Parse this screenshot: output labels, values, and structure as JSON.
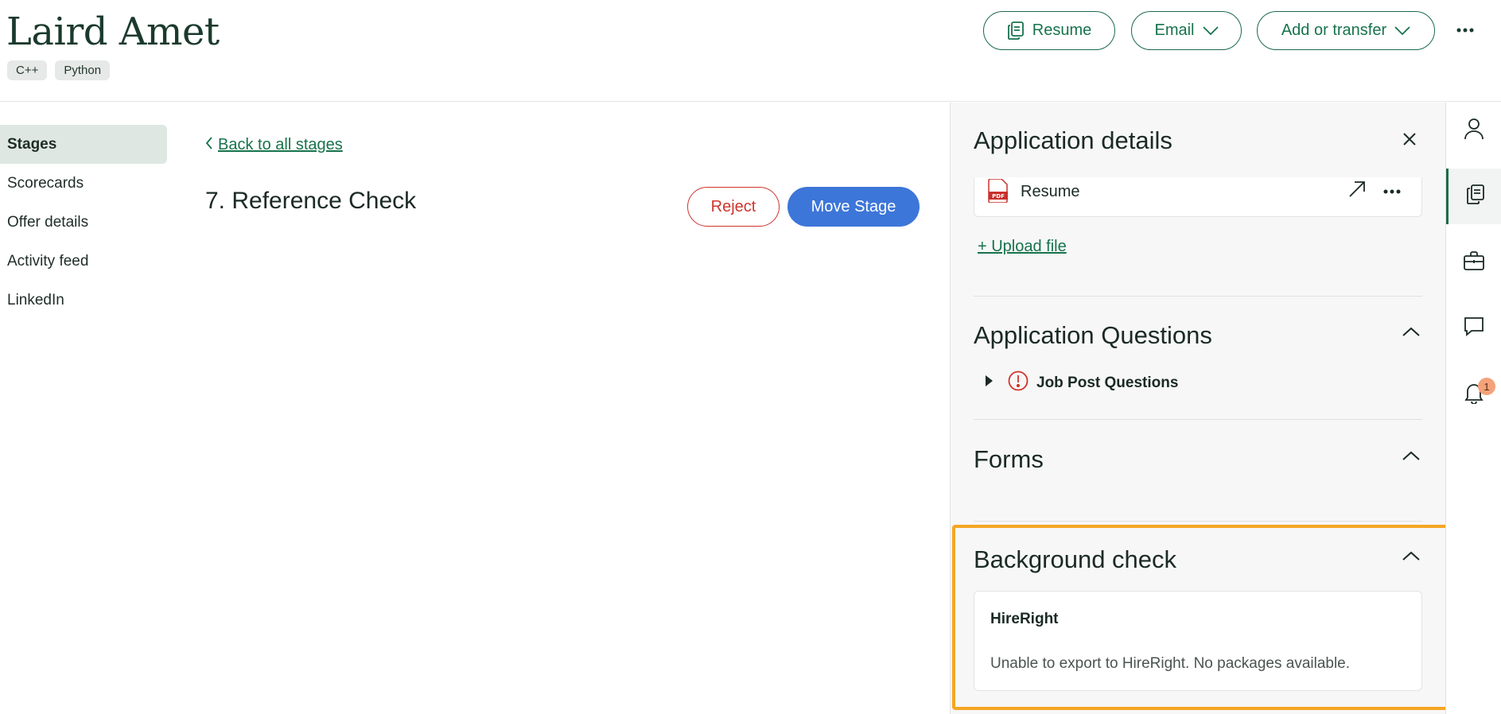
{
  "candidate": {
    "name": "Laird Amet",
    "tags": [
      "C++",
      "Python"
    ]
  },
  "header": {
    "resume_label": "Resume",
    "email_label": "Email",
    "transfer_label": "Add or transfer"
  },
  "leftnav": {
    "items": [
      {
        "label": "Stages",
        "active": true
      },
      {
        "label": "Scorecards",
        "active": false
      },
      {
        "label": "Offer details",
        "active": false
      },
      {
        "label": "Activity feed",
        "active": false
      },
      {
        "label": "LinkedIn",
        "active": false
      }
    ]
  },
  "main": {
    "back_label": "Back to all stages",
    "stage_title": "7. Reference Check",
    "reject_label": "Reject",
    "move_label": "Move Stage"
  },
  "panel": {
    "title": "Application details",
    "file_name": "Resume",
    "upload_label": "+ Upload file",
    "questions_title": "Application Questions",
    "job_post_questions": "Job Post Questions",
    "forms_title": "Forms",
    "background_title": "Background check",
    "background_vendor": "HireRight",
    "background_message": "Unable to export to HireRight. No packages available."
  },
  "rail": {
    "notification_count": "1"
  },
  "colors": {
    "brand_green": "#17734c",
    "primary_blue": "#3d76d9",
    "danger_red": "#d0342c",
    "highlight_orange": "#f5a623"
  }
}
